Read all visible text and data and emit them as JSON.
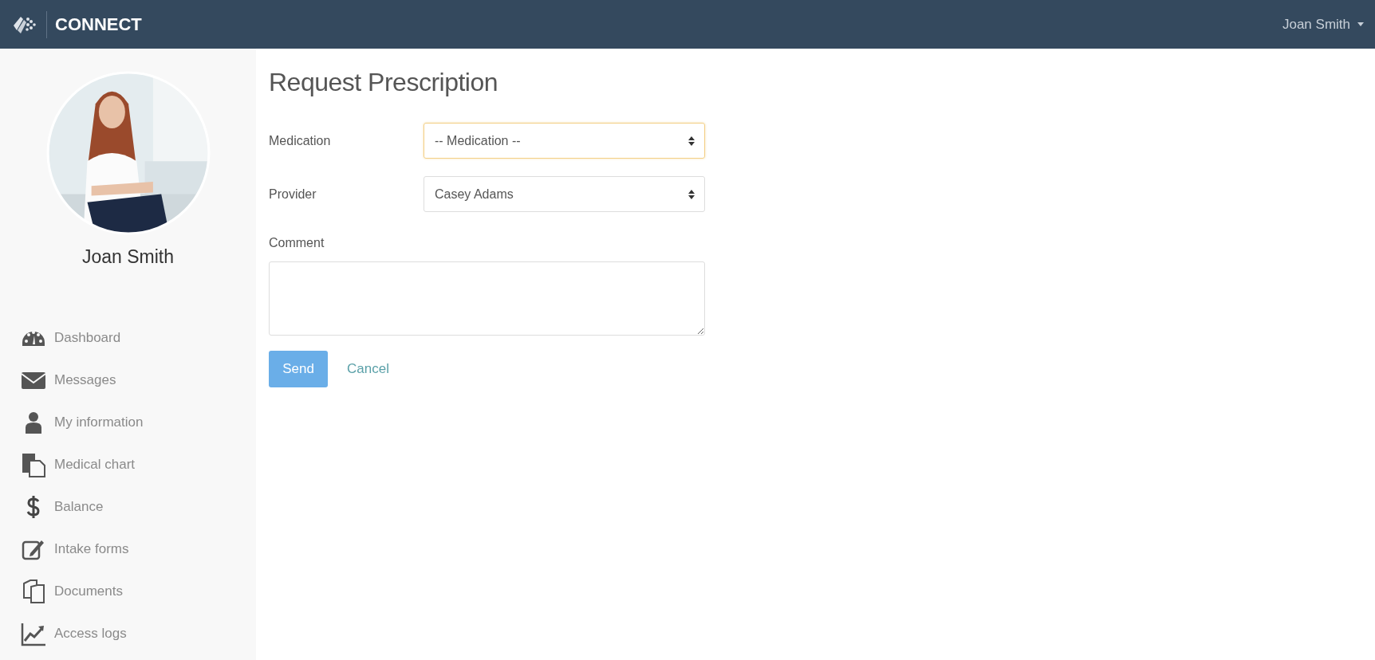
{
  "header": {
    "brand": "CONNECT",
    "user_menu": "Joan Smith"
  },
  "sidebar": {
    "profile": {
      "name": "Joan Smith"
    },
    "items": [
      {
        "label": "Dashboard"
      },
      {
        "label": "Messages"
      },
      {
        "label": "My information"
      },
      {
        "label": "Medical chart"
      },
      {
        "label": "Balance"
      },
      {
        "label": "Intake forms"
      },
      {
        "label": "Documents"
      },
      {
        "label": "Access logs"
      }
    ]
  },
  "form": {
    "title": "Request Prescription",
    "fields": [
      {
        "kind": "select",
        "label": "Medication",
        "value": "-- Medication --",
        "focused": true
      },
      {
        "kind": "select",
        "label": "Provider",
        "value": "Casey Adams",
        "focused": false
      },
      {
        "kind": "textarea",
        "label": "Comment",
        "focused": false
      }
    ],
    "buttons": [
      {
        "kind": "primary",
        "label": "Send"
      },
      {
        "kind": "link",
        "label": "Cancel"
      }
    ]
  }
}
